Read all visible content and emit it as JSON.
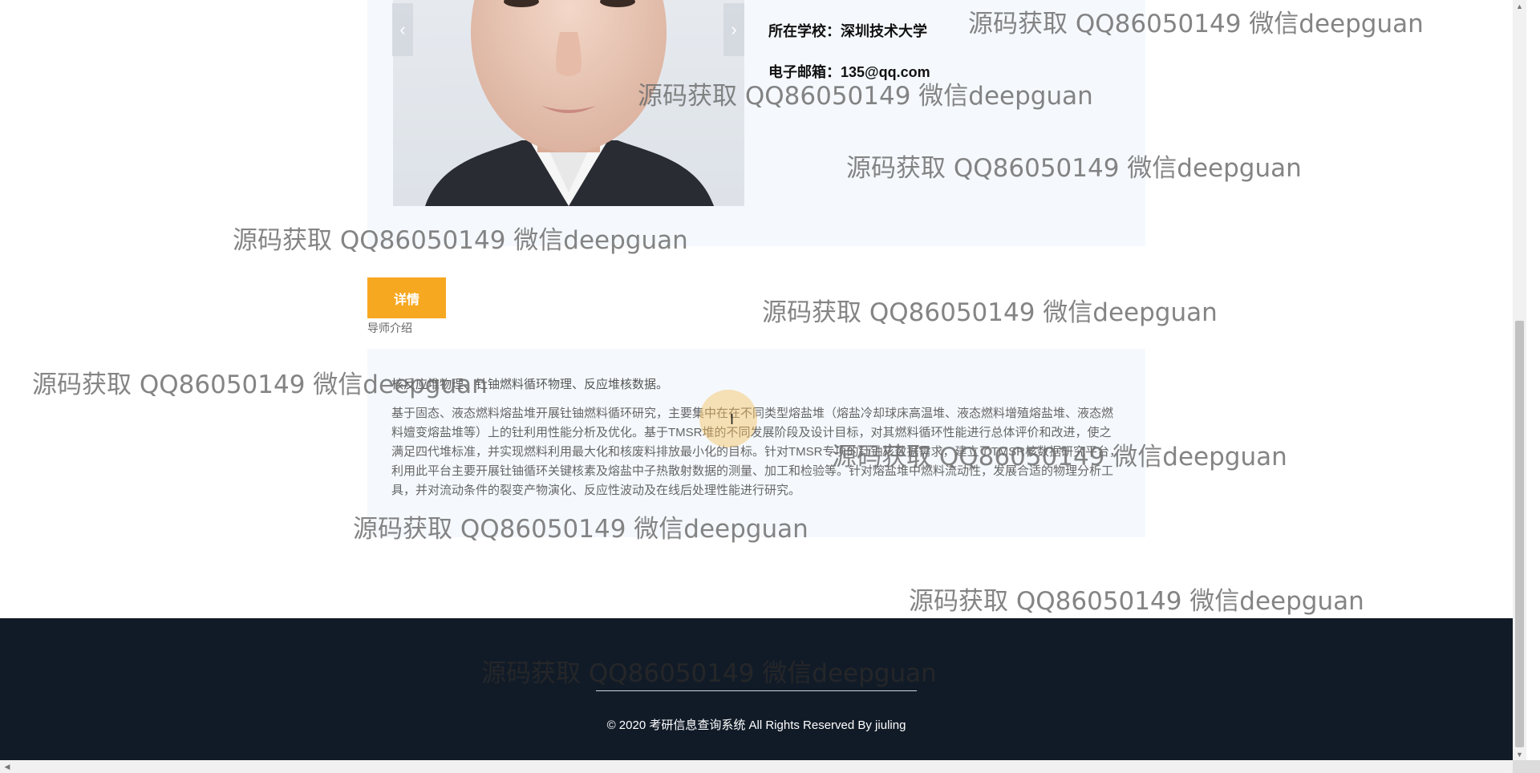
{
  "teacher": {
    "school": "所在学校：深圳技术大学",
    "email": "电子邮箱：135@qq.com",
    "carousel_prev": "‹",
    "carousel_next": "›"
  },
  "detail_button": "详情",
  "section_label": "导师介绍",
  "intro": {
    "field": "核反应堆物理、钍铀燃料循环物理、反应堆核数据。",
    "body": "基于固态、液态燃料熔盐堆开展钍铀燃料循环研究，主要集中在在不同类型熔盐堆（熔盐冷却球床高温堆、液态燃料增殖熔盐堆、液态燃料嬗变熔盐堆等）上的钍利用性能分析及优化。基于TMSR堆的不同发展阶段及设计目标，对其燃料循环性能进行总体评价和改进，使之满足四代堆标准，并实现燃料利用最大化和核废料排放最小化的目标。针对TMSR专项的钍铀核数据需求，建立了TMSR核数据研究平台，利用此平台主要开展钍铀循环关键核素及熔盐中子热散射数据的测量、加工和检验等。针对熔盐堆中燃料流动性，发展合适的物理分析工具，并对流动条件的裂变产物演化、反应性波动及在线后处理性能进行研究。"
  },
  "footer": {
    "copyright": "© 2020 考研信息查询系统 All Rights Reserved By jiuling"
  },
  "watermark_text": "源码获取 QQ86050149 微信deepguan",
  "colors": {
    "accent": "#f7a821",
    "footer_bg": "#111b28",
    "card_bg": "#f5f9fd"
  }
}
